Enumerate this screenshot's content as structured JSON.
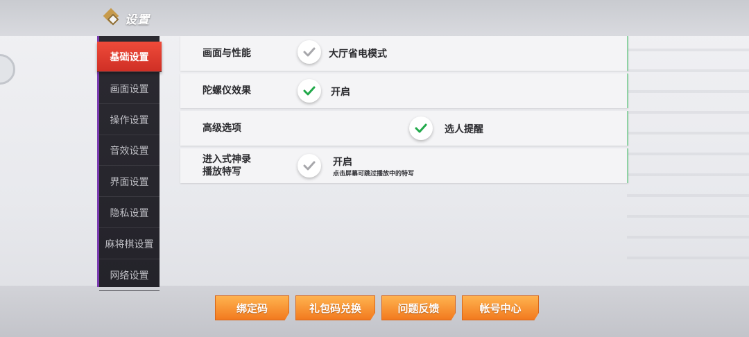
{
  "header": {
    "title": "设置",
    "icon": "diamond-logo-icon"
  },
  "sidebar": {
    "items": [
      {
        "label": "基础设置",
        "active": true
      },
      {
        "label": "画面设置",
        "active": false
      },
      {
        "label": "操作设置",
        "active": false
      },
      {
        "label": "音效设置",
        "active": false
      },
      {
        "label": "界面设置",
        "active": false
      },
      {
        "label": "隐私设置",
        "active": false
      },
      {
        "label": "麻将棋设置",
        "active": false
      },
      {
        "label": "网络设置",
        "active": false
      }
    ]
  },
  "settings": {
    "rows": [
      {
        "label": "画面与性能",
        "option": "大厅省电模式",
        "checked": false
      },
      {
        "label": "陀螺仪效果",
        "option": "开启",
        "checked": true
      },
      {
        "label": "高级选项",
        "option": "选人提醒",
        "checked": true
      },
      {
        "label_line1": "进入式神录",
        "label_line2": "播放特写",
        "option": "开启",
        "option_sub": "点击屏幕可跳过播放中的特写",
        "checked": false
      }
    ]
  },
  "buttons": {
    "bind_code": "绑定码",
    "gift_code": "礼包码兑换",
    "feedback": "问题反馈",
    "account": "帐号中心"
  },
  "colors": {
    "accent_active": "#e0392d",
    "check_on": "#21a94a",
    "check_off": "#a7a7ab",
    "button": "#f58a2a"
  }
}
